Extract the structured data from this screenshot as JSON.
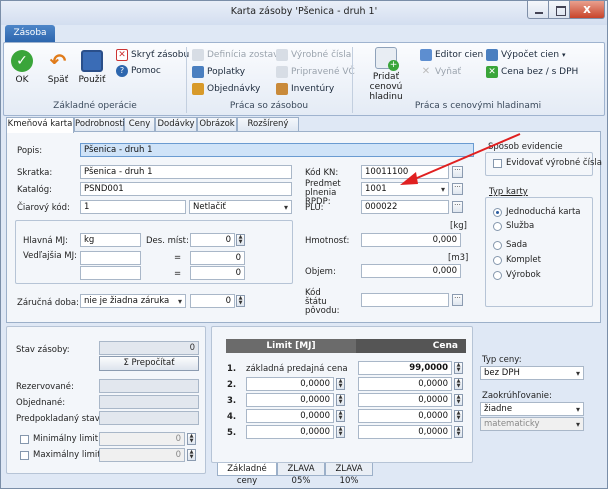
{
  "window": {
    "title": "Karta zásoby 'Pšenica - druh 1'",
    "close_glyph": "x"
  },
  "ribbon": {
    "tab": "Zásoba",
    "groups": [
      {
        "label": "Základné operácie"
      },
      {
        "label": "Práca so zásobou"
      },
      {
        "label": "Práca s cenovými hladinami"
      }
    ],
    "ok": "OK",
    "back": "Späť",
    "use": "Použiť",
    "hide": "Skryť zásobu",
    "help": "Pomoc",
    "set_def": "Definícia zostavy",
    "fees": "Poplatky",
    "orders": "Objednávky",
    "serials": "Výrobné čísla",
    "prepared": "Pripravené VČ",
    "inventory": "Inventúry",
    "add_price": "Pridať cenovú hladinu",
    "editor": "Editor cien",
    "remove": "Vyňať",
    "calc": "Výpočet cien",
    "price_vat": "Cena bez / s DPH"
  },
  "tabs": [
    "Kmeňová karta",
    "Podrobnosti",
    "Ceny",
    "Dodávky",
    "Obrázok",
    "Rozšírený popis"
  ],
  "form": {
    "popis_label": "Popis:",
    "popis_value": "Pšenica - druh 1",
    "skratka_label": "Skratka:",
    "skratka_value": "Pšenica - druh 1",
    "katalog_label": "Katalóg:",
    "katalog_value": "PSND001",
    "ciarovy_label": "Čiarový kód:",
    "ciarovy_value": "1",
    "ciarovy_print": "Netlačiť",
    "kodkn_label": "Kód KN:",
    "kodkn_value": "10011100",
    "rpdp_label": "Predmet plnenia RPDP:",
    "rpdp_value": "1001",
    "plu_label": "PLU:",
    "plu_value": "000022",
    "hlavna_label": "Hlavná MJ:",
    "hlavna_value": "kg",
    "des_label": "Des. míst:",
    "des_value": "0",
    "vedl_label": "Vedľajšia MJ:",
    "eq1": "=",
    "eq2": "=",
    "vedl1_value": "0",
    "vedl2_value": "0",
    "hmot_label": "Hmotnosť:",
    "hmot_unit": "[kg]",
    "hmot_value": "0,000",
    "objem_label": "Objem:",
    "objem_unit": "[m3]",
    "objem_value": "0,000",
    "zaruka_label": "Záručná doba:",
    "zaruka_value": "nie je žiadna záruka",
    "zaruka_num": "0",
    "kod_statu_label": "Kód štátu pôvodu:"
  },
  "evidence": {
    "title": "Spôsob evidencie",
    "checkbox": "Evidovať výrobné čísla"
  },
  "typ_karty": {
    "title": "Typ karty",
    "options": [
      "Jednoduchá karta",
      "Služba",
      "Sada",
      "Komplet",
      "Výrobok"
    ],
    "selected": 0
  },
  "stock": {
    "stav_label": "Stav zásoby:",
    "stav_value": "0",
    "prepocitat": "Σ Prepočítať",
    "rez_label": "Rezervované:",
    "obj_label": "Objednané:",
    "pred_label": "Predpokladaný stav:",
    "min_label": "Minimálny limit:",
    "min_value": "0",
    "max_label": "Maximálny limit:",
    "max_value": "0"
  },
  "prices": {
    "col_limit": "Limit [MJ]",
    "col_cena": "Cena",
    "rows": [
      {
        "n": "1.",
        "label": "základná predajná cena",
        "price": "99,0000"
      },
      {
        "n": "2.",
        "limit": "0,0000",
        "price": "0,0000"
      },
      {
        "n": "3.",
        "limit": "0,0000",
        "price": "0,0000"
      },
      {
        "n": "4.",
        "limit": "0,0000",
        "price": "0,0000"
      },
      {
        "n": "5.",
        "limit": "0,0000",
        "price": "0,0000"
      }
    ],
    "tabs": [
      "Základné ceny",
      "ZLAVA 05%",
      "ZLAVA 10%"
    ]
  },
  "side": {
    "typ_ceny_label": "Typ ceny:",
    "typ_ceny_value": "bez DPH",
    "zaokr_label": "Zaokrúhľovanie:",
    "zaokr_value": "žiadne",
    "zaokr2_value": "matematicky"
  },
  "colors": {
    "accent": "#2d66ae",
    "arrow": "#e02020",
    "price_header": "#6b6b6b"
  }
}
